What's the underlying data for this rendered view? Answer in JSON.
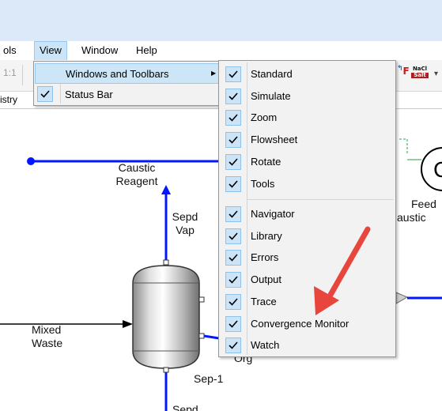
{
  "menubar": {
    "items": [
      {
        "label": "ols"
      },
      {
        "label": "View"
      },
      {
        "label": "Window"
      },
      {
        "label": "Help"
      }
    ]
  },
  "toolbar": {
    "zoom_ratio": "1:1",
    "toggle_icon_text": "F",
    "naoh_icon_text": "NaCl Salt"
  },
  "tabstrip": {
    "partial_tab": "istry"
  },
  "view_menu": {
    "items": [
      {
        "label": "Windows and Toolbars",
        "has_submenu": true,
        "checked": false
      },
      {
        "label": "Status Bar",
        "checked": true
      }
    ]
  },
  "submenu": {
    "group1": [
      {
        "label": "Standard",
        "checked": true
      },
      {
        "label": "Simulate",
        "checked": true
      },
      {
        "label": "Zoom",
        "checked": true
      },
      {
        "label": "Flowsheet",
        "checked": true
      },
      {
        "label": "Rotate",
        "checked": true
      },
      {
        "label": "Tools",
        "checked": true
      }
    ],
    "group2": [
      {
        "label": "Navigator",
        "checked": true
      },
      {
        "label": "Library",
        "checked": true
      },
      {
        "label": "Errors",
        "checked": true
      },
      {
        "label": "Output",
        "checked": true
      },
      {
        "label": "Trace",
        "checked": true
      },
      {
        "label": "Convergence Monitor",
        "checked": true
      },
      {
        "label": "Watch",
        "checked": true
      }
    ]
  },
  "flowsheet": {
    "caustic_reagent": "Caustic\nReagent",
    "sepd_vap": "Sepd\nVap",
    "mixed_waste": "Mixed\nWaste",
    "sep1": "Sep-1",
    "org": "Org",
    "feed": "Feed",
    "caustic_partial": "austic",
    "sepd_bottom": "Sepd",
    "feed_circle_letter": "C"
  },
  "colors": {
    "titlebar": "#dce9f9",
    "menu_highlight": "#cce4f7",
    "stream_blue": "#0018ff",
    "annotation_arrow": "#e8453c"
  }
}
